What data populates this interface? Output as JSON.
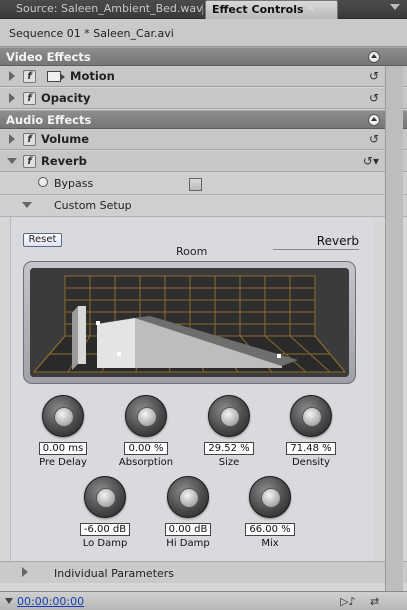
{
  "tabs": {
    "source": "Source: Saleen_Ambient_Bed.wav",
    "effect_controls": "Effect Controls",
    "close_glyph": "×"
  },
  "sequence": "Sequence 01 * Saleen_Car.avi",
  "sections": {
    "video": "Video Effects",
    "audio": "Audio Effects"
  },
  "effects": {
    "motion": "Motion",
    "opacity": "Opacity",
    "volume": "Volume",
    "reverb": "Reverb",
    "fx_glyph": "f"
  },
  "reverb": {
    "bypass_label": "Bypass",
    "bypass_checked": false,
    "custom_setup_label": "Custom Setup",
    "reset_label": "Reset",
    "room_label": "Room",
    "preset_label": "Reverb",
    "knobs": [
      {
        "value": "0.00 ms",
        "label": "Pre Delay"
      },
      {
        "value": "0.00 %",
        "label": "Absorption"
      },
      {
        "value": "29.52 %",
        "label": "Size"
      },
      {
        "value": "71.48 %",
        "label": "Density"
      },
      {
        "value": "-6.00 dB",
        "label": "Lo Damp"
      },
      {
        "value": "0.00 dB",
        "label": "Hi Damp"
      },
      {
        "value": "66.00 %",
        "label": "Mix"
      }
    ],
    "individual_parameters_label": "Individual Parameters"
  },
  "bottom": {
    "timecode": "00:00:00:00"
  },
  "icons": {
    "reset": "reset-icon",
    "stopwatch": "stopwatch-icon",
    "collapse": "collapse-up-icon"
  }
}
